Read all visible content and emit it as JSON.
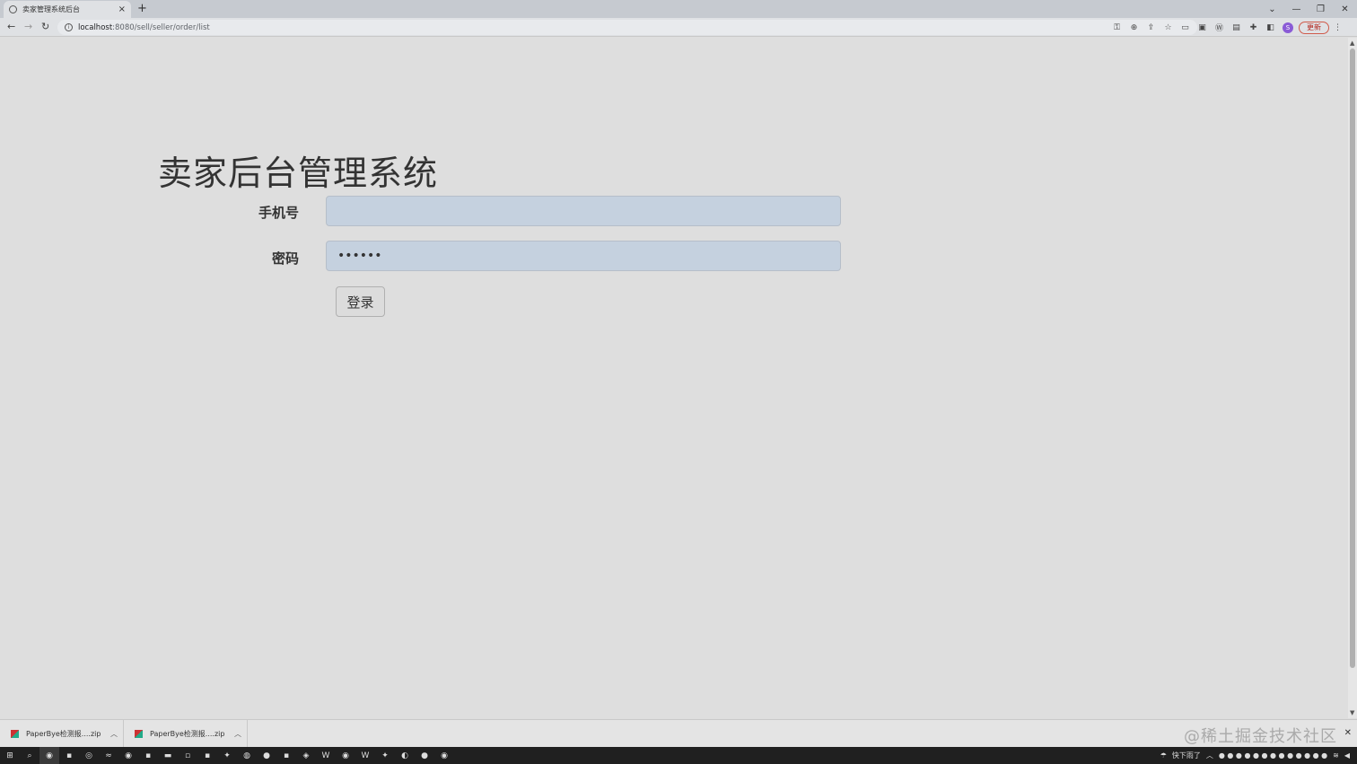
{
  "browser": {
    "tab_title": "卖家管理系统后台",
    "tab_close": "×",
    "new_tab": "+",
    "url_host": "localhost",
    "url_path": ":8080/sell/seller/order/list",
    "update_label": "更新",
    "profile_initial": "S"
  },
  "page": {
    "title": "卖家后台管理系统",
    "phone_label": "手机号",
    "phone_value": "",
    "password_label": "密码",
    "password_value": "123456",
    "login_label": "登录"
  },
  "downloads": [
    {
      "name": "PaperBye检测报....zip"
    },
    {
      "name": "PaperBye检测报....zip"
    }
  ],
  "watermark": "@稀土掘金技术社区",
  "taskbar": {
    "weather": "快下雨了"
  },
  "colors": {
    "page_bg": "#dedede",
    "input_bg": "#c5d1df",
    "taskbar_bg": "#202020"
  }
}
